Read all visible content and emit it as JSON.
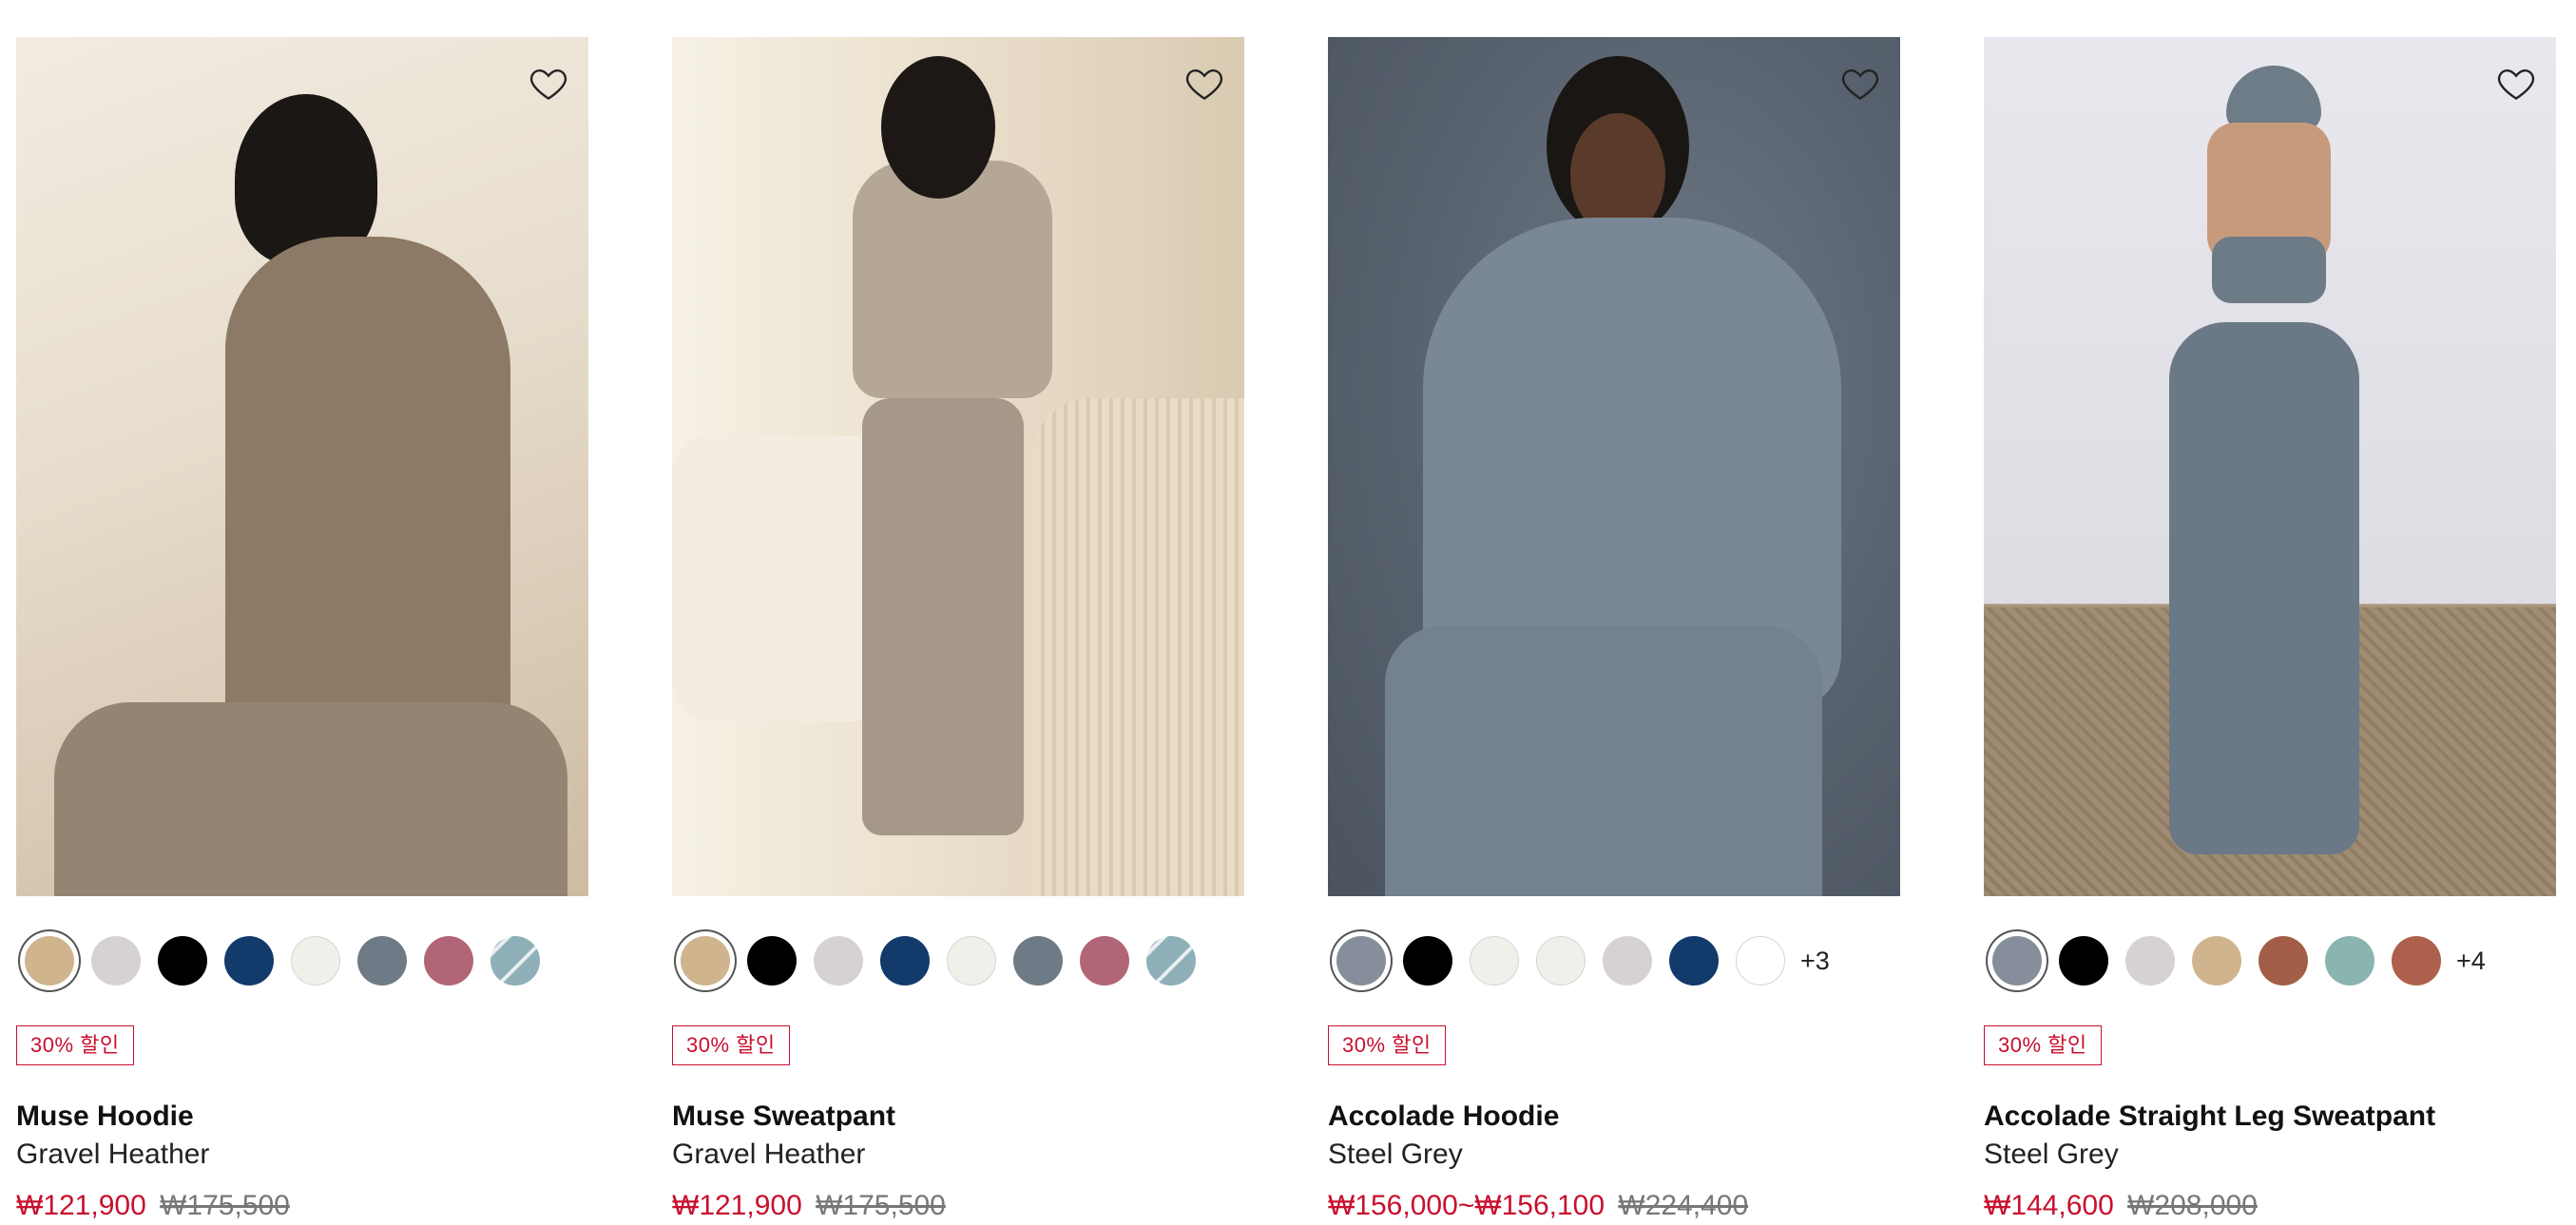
{
  "colors": {
    "sale_red": "#c8102e",
    "heart_stroke": "#222222"
  },
  "products": [
    {
      "name": "Muse Hoodie",
      "color_name": "Gravel Heather",
      "badge": "30% 할인",
      "sale_price": "₩121,900",
      "original_price": "₩175,500",
      "more_colors": "",
      "swatches": [
        "#cfb48e",
        "#d6d1d4",
        "#000000",
        "#123a6b",
        "#f1efe9",
        "#6e7a86",
        "#b06677",
        "striped"
      ]
    },
    {
      "name": "Muse Sweatpant",
      "color_name": "Gravel Heather",
      "badge": "30% 할인",
      "sale_price": "₩121,900",
      "original_price": "₩175,500",
      "more_colors": "",
      "swatches": [
        "#cfb48e",
        "#000000",
        "#d6d1d4",
        "#123a6b",
        "#f1efe9",
        "#6e7a86",
        "#b06677",
        "striped"
      ]
    },
    {
      "name": "Accolade Hoodie",
      "color_name": "Steel Grey",
      "badge": "30% 할인",
      "sale_price": "₩156,000~₩156,100",
      "original_price": "₩224,400",
      "more_colors": "+3",
      "swatches": [
        "#858e9a",
        "#000000",
        "#f1efe9",
        "#f1efe9",
        "#d6d1d4",
        "#123a6b",
        "#ffffff"
      ]
    },
    {
      "name": "Accolade Straight Leg Sweatpant",
      "color_name": "Steel Grey",
      "badge": "30% 할인",
      "sale_price": "₩144,600",
      "original_price": "₩208,000",
      "more_colors": "+4",
      "swatches": [
        "#858e9a",
        "#000000",
        "#d6d1d4",
        "#cfb48e",
        "#a35e48",
        "#8ab4b0",
        "#ad604b"
      ]
    }
  ]
}
